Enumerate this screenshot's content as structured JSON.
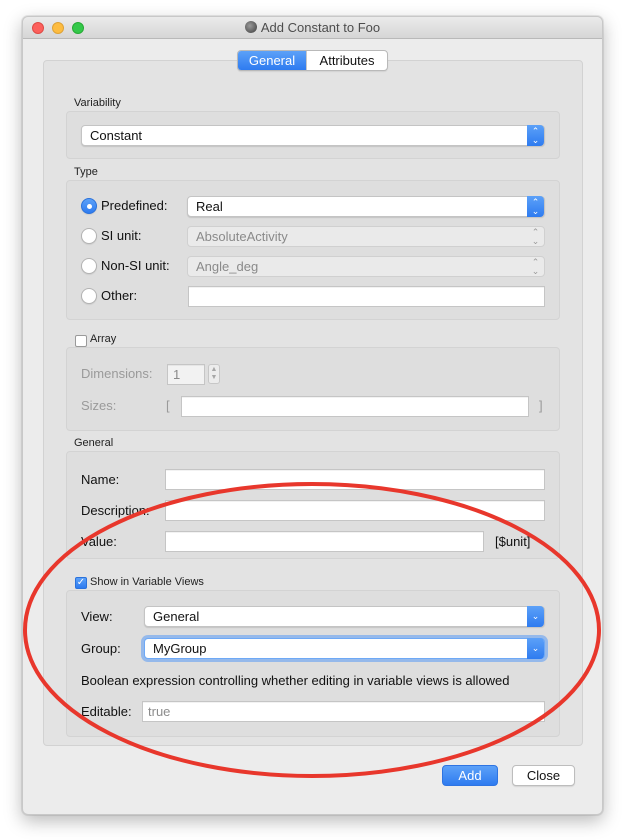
{
  "window": {
    "title": "Add Constant to Foo"
  },
  "tabs": [
    {
      "label": "General",
      "selected": true
    },
    {
      "label": "Attributes",
      "selected": false
    }
  ],
  "variability": {
    "label": "Variability",
    "value": "Constant"
  },
  "type": {
    "label": "Type",
    "options": [
      {
        "label": "Predefined:",
        "selected": true,
        "value": "Real"
      },
      {
        "label": "SI unit:",
        "selected": false,
        "value": "AbsoluteActivity"
      },
      {
        "label": "Non-SI unit:",
        "selected": false,
        "value": "Angle_deg"
      },
      {
        "label": "Other:",
        "selected": false,
        "value": ""
      }
    ]
  },
  "array": {
    "label": "Array",
    "checked": false,
    "dimensions_label": "Dimensions:",
    "dimensions_value": "1",
    "sizes_label": "Sizes:",
    "sizes_open": "[",
    "sizes_close": "]",
    "sizes_value": ""
  },
  "general": {
    "label": "General",
    "name_label": "Name:",
    "name_value": "",
    "description_label": "Description:",
    "description_value": "",
    "value_label": "Value:",
    "value_value": "",
    "unit_hint": "[$unit]"
  },
  "variable_views": {
    "label": "Show in Variable Views",
    "checked": true,
    "view_label": "View:",
    "view_value": "General",
    "group_label": "Group:",
    "group_value": "MyGroup",
    "description": "Boolean expression controlling whether editing in variable views is allowed",
    "editable_label": "Editable:",
    "editable_placeholder": "true"
  },
  "buttons": {
    "add": "Add",
    "close": "Close"
  },
  "colors": {
    "accent": "#2e7bf0",
    "annotation": "#e8372c"
  },
  "icons": {
    "popup_arrows": "⌃⌄",
    "checkmark": "✓"
  }
}
